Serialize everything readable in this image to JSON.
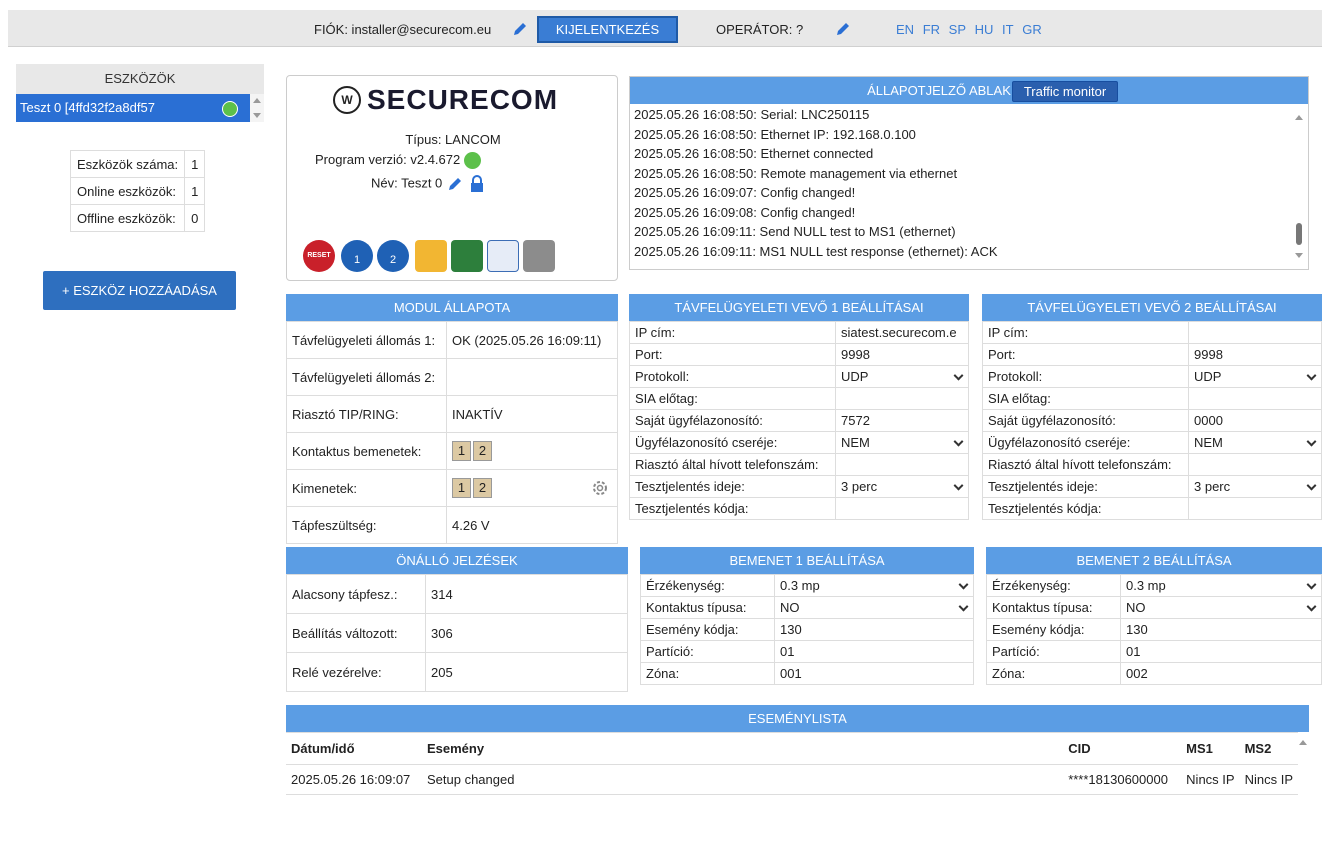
{
  "topbar": {
    "account_label": "FIÓK: installer@securecom.eu",
    "logout_label": "KIJELENTKEZÉS",
    "operator_label": "OPERÁTOR: ?",
    "languages": [
      "EN",
      "FR",
      "SP",
      "HU",
      "IT",
      "GR"
    ]
  },
  "devices": {
    "header": "ESZKÖZÖK",
    "selected": "Teszt 0  [4ffd32f2a8df57",
    "stats": [
      {
        "label": "Eszközök száma:",
        "value": "1"
      },
      {
        "label": "Online eszközök:",
        "value": "1"
      },
      {
        "label": "Offline eszközök:",
        "value": "0"
      }
    ],
    "add_label": "+ ESZKÖZ HOZZÁADÁSA"
  },
  "info": {
    "logo": "SECURECOM",
    "type": "Típus: LANCOM",
    "program": "Program verzió: v2.4.672",
    "name": "Név: Teszt 0",
    "reset_label": "RESET"
  },
  "status": {
    "title": "ÁLLAPOTJELZŐ ABLAK",
    "traffic_label": "Traffic monitor",
    "lines": [
      "2025.05.26 16:08:50: Serial: LNC250115",
      "2025.05.26 16:08:50: Ethernet IP: 192.168.0.100",
      "2025.05.26 16:08:50: Ethernet connected",
      "2025.05.26 16:08:50: Remote management via ethernet",
      "2025.05.26 16:09:07: Config changed!",
      "2025.05.26 16:09:08: Config changed!",
      "2025.05.26 16:09:11: Send NULL test to MS1 (ethernet)",
      "2025.05.26 16:09:11: MS1 NULL test response (ethernet): ACK"
    ]
  },
  "module": {
    "title": "MODUL ÁLLAPOTA",
    "rows": [
      {
        "label": "Távfelügyeleti állomás 1:",
        "value": "OK (2025.05.26 16:09:11)"
      },
      {
        "label": "Távfelügyeleti állomás 2:",
        "value": ""
      },
      {
        "label": "Riasztó TIP/RING:",
        "value": "INAKTÍV"
      },
      {
        "label": "Kontaktus bemenetek:",
        "value": ""
      },
      {
        "label": "Kimenetek:",
        "value": ""
      },
      {
        "label": "Tápfeszültség:",
        "value": "4.26 V"
      }
    ],
    "box1": "1",
    "box2": "2"
  },
  "recv1": {
    "title": "TÁVFELÜGYELETI VEVŐ 1 BEÁLLÍTÁSAI",
    "rows": [
      {
        "label": "IP cím:",
        "value": "siatest.securecom.e"
      },
      {
        "label": "Port:",
        "value": "9998"
      },
      {
        "label": "Protokoll:",
        "value": "UDP"
      },
      {
        "label": "SIA előtag:",
        "value": ""
      },
      {
        "label": "Saját ügyfélazonosító:",
        "value": "7572"
      },
      {
        "label": "Ügyfélazonosító cseréje:",
        "value": "NEM"
      },
      {
        "label": "Riasztó által hívott telefonszám:",
        "value": ""
      },
      {
        "label": "Tesztjelentés ideje:",
        "value": "3 perc"
      },
      {
        "label": "Tesztjelentés kódja:",
        "value": ""
      }
    ]
  },
  "recv2": {
    "title": "TÁVFELÜGYELETI VEVŐ 2 BEÁLLÍTÁSAI",
    "rows": [
      {
        "label": "IP cím:",
        "value": ""
      },
      {
        "label": "Port:",
        "value": "9998"
      },
      {
        "label": "Protokoll:",
        "value": "UDP"
      },
      {
        "label": "SIA előtag:",
        "value": ""
      },
      {
        "label": "Saját ügyfélazonosító:",
        "value": "0000"
      },
      {
        "label": "Ügyfélazonosító cseréje:",
        "value": "NEM"
      },
      {
        "label": "Riasztó által hívott telefonszám:",
        "value": ""
      },
      {
        "label": "Tesztjelentés ideje:",
        "value": "3 perc"
      },
      {
        "label": "Tesztjelentés kódja:",
        "value": ""
      }
    ]
  },
  "alerts": {
    "title": "ÖNÁLLÓ JELZÉSEK",
    "rows": [
      {
        "label": "Alacsony tápfesz.:",
        "value": "314"
      },
      {
        "label": "Beállítás változott:",
        "value": "306"
      },
      {
        "label": "Relé vezérelve:",
        "value": "205"
      }
    ]
  },
  "input1": {
    "title": "BEMENET 1 BEÁLLÍTÁSA",
    "rows": [
      {
        "label": "Érzékenység:",
        "value": "0.3 mp"
      },
      {
        "label": "Kontaktus típusa:",
        "value": "NO"
      },
      {
        "label": "Esemény kódja:",
        "value": "130"
      },
      {
        "label": "Partíció:",
        "value": "01"
      },
      {
        "label": "Zóna:",
        "value": "001"
      }
    ]
  },
  "input2": {
    "title": "BEMENET 2 BEÁLLÍTÁSA",
    "rows": [
      {
        "label": "Érzékenység:",
        "value": "0.3 mp"
      },
      {
        "label": "Kontaktus típusa:",
        "value": "NO"
      },
      {
        "label": "Esemény kódja:",
        "value": "130"
      },
      {
        "label": "Partíció:",
        "value": "01"
      },
      {
        "label": "Zóna:",
        "value": "002"
      }
    ]
  },
  "events": {
    "title": "ESEMÉNYLISTA",
    "headers": {
      "date": "Dátum/idő",
      "event": "Esemény",
      "cid": "CID",
      "ms1": "MS1",
      "ms2": "MS2"
    },
    "row": {
      "date": "2025.05.26 16:09:07",
      "event": "Setup changed",
      "cid": "****18130600000",
      "ms1": "Nincs IP",
      "ms2": "Nincs IP"
    }
  }
}
